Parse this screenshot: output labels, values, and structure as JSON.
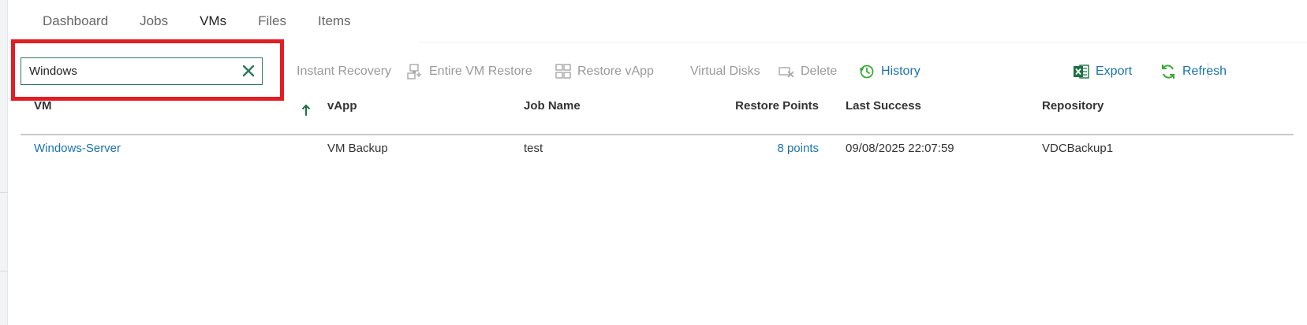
{
  "tabs": [
    {
      "label": "Dashboard",
      "active": false
    },
    {
      "label": "Jobs",
      "active": false
    },
    {
      "label": "VMs",
      "active": true
    },
    {
      "label": "Files",
      "active": false
    },
    {
      "label": "Items",
      "active": false
    }
  ],
  "search": {
    "value": "Windows",
    "clear_icon": "close-x-icon"
  },
  "toolbar": {
    "instant_recovery": "Instant Recovery",
    "entire_vm_restore": "Entire VM Restore",
    "restore_vapp": "Restore vApp",
    "virtual_disks": "Virtual Disks",
    "delete": "Delete",
    "history": "History",
    "export": "Export",
    "refresh": "Refresh"
  },
  "table": {
    "columns": {
      "vm": "VM",
      "vapp": "vApp",
      "job_name": "Job Name",
      "restore_points": "Restore Points",
      "last_success": "Last Success",
      "repository": "Repository"
    },
    "sort": {
      "column": "VM",
      "direction": "ascending"
    },
    "rows": [
      {
        "vm": "Windows-Server",
        "vapp": "VM Backup",
        "job_name": "test",
        "restore_points": "8 points",
        "last_success": "09/08/2025 22:07:59",
        "repository": "VDCBackup1"
      }
    ]
  },
  "colors": {
    "accent_link": "#1a73ad",
    "highlight_red": "#e21d24",
    "search_border": "#2a7a5a",
    "disabled_text": "#9a9a9a",
    "history_green": "#3aaa35",
    "export_green": "#1d7044"
  }
}
